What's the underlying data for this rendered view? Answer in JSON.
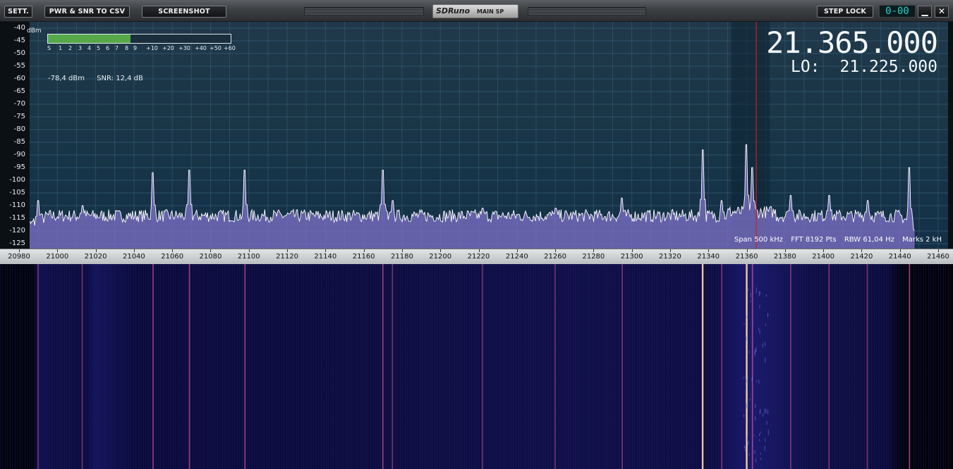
{
  "toolbar": {
    "sett_label": "SETT.",
    "csv_label": "PWR & SNR TO CSV",
    "screenshot_label": "SCREENSHOT",
    "brand_logo": "SDRuno",
    "brand_tag": "MAIN SP",
    "steplock_label": "STEP LOCK",
    "lcd_value": "0-00",
    "minimize_glyph": "▁",
    "close_glyph": "✕"
  },
  "display": {
    "vfo_frequency": "21.365.000",
    "lo_label": "LO:",
    "lo_frequency": "21.225.000",
    "dbm_unit": "dBm",
    "power_reading": "-78,4 dBm",
    "snr_reading": "SNR: 12,4 dB",
    "span": "Span 500 kHz",
    "fft": "FFT 8192 Pts",
    "rbw": "RBW 61,04 Hz",
    "marks": "Marks 2 kH"
  },
  "smeter": {
    "labels": [
      "S",
      "1",
      "2",
      "3",
      "4",
      "5",
      "6",
      "7",
      "8",
      "9",
      "+10",
      "+20",
      "+30",
      "+40",
      "+50",
      "+60"
    ],
    "level_fraction": 0.45
  },
  "colors": {
    "spectrum_fill": "#7b6fc4",
    "spectrum_line": "#ffffff",
    "tuning_cursor": "#d21d1d",
    "smeter_fill": "#57a84a",
    "frequency_text": "#f4f8fb"
  },
  "chart_data": {
    "type": "line",
    "title": "",
    "xlabel": "",
    "ylabel": "dBm",
    "xlim": [
      20980,
      21460
    ],
    "ylim": [
      -125,
      -40
    ],
    "y_ticks": [
      -40,
      -45,
      -50,
      -55,
      -60,
      -65,
      -70,
      -75,
      -80,
      -85,
      -90,
      -95,
      -100,
      -105,
      -110,
      -115,
      -120,
      -125
    ],
    "x_ticks": [
      20980,
      21000,
      21020,
      21040,
      21060,
      21080,
      21100,
      21120,
      21140,
      21160,
      21180,
      21200,
      21220,
      21240,
      21260,
      21280,
      21300,
      21320,
      21340,
      21360,
      21380,
      21400,
      21420,
      21440,
      21460
    ],
    "noise_floor_dbm": -114,
    "grid": true,
    "tuned_frequency": 21365,
    "filter_band": [
      21352,
      21372
    ],
    "series": [
      {
        "peaks": [
          {
            "x": 20990,
            "y": -108
          },
          {
            "x": 21013,
            "y": -110
          },
          {
            "x": 21050,
            "y": -97
          },
          {
            "x": 21069,
            "y": -96
          },
          {
            "x": 21098,
            "y": -96
          },
          {
            "x": 21170,
            "y": -96
          },
          {
            "x": 21175,
            "y": -108
          },
          {
            "x": 21222,
            "y": -111
          },
          {
            "x": 21260,
            "y": -111
          },
          {
            "x": 21295,
            "y": -107
          },
          {
            "x": 21337,
            "y": -88
          },
          {
            "x": 21347,
            "y": -108
          },
          {
            "x": 21360,
            "y": -86
          },
          {
            "x": 21363,
            "y": -95
          },
          {
            "x": 21383,
            "y": -106
          },
          {
            "x": 21403,
            "y": -106
          },
          {
            "x": 21423,
            "y": -108
          },
          {
            "x": 21445,
            "y": -95
          }
        ]
      }
    ]
  }
}
